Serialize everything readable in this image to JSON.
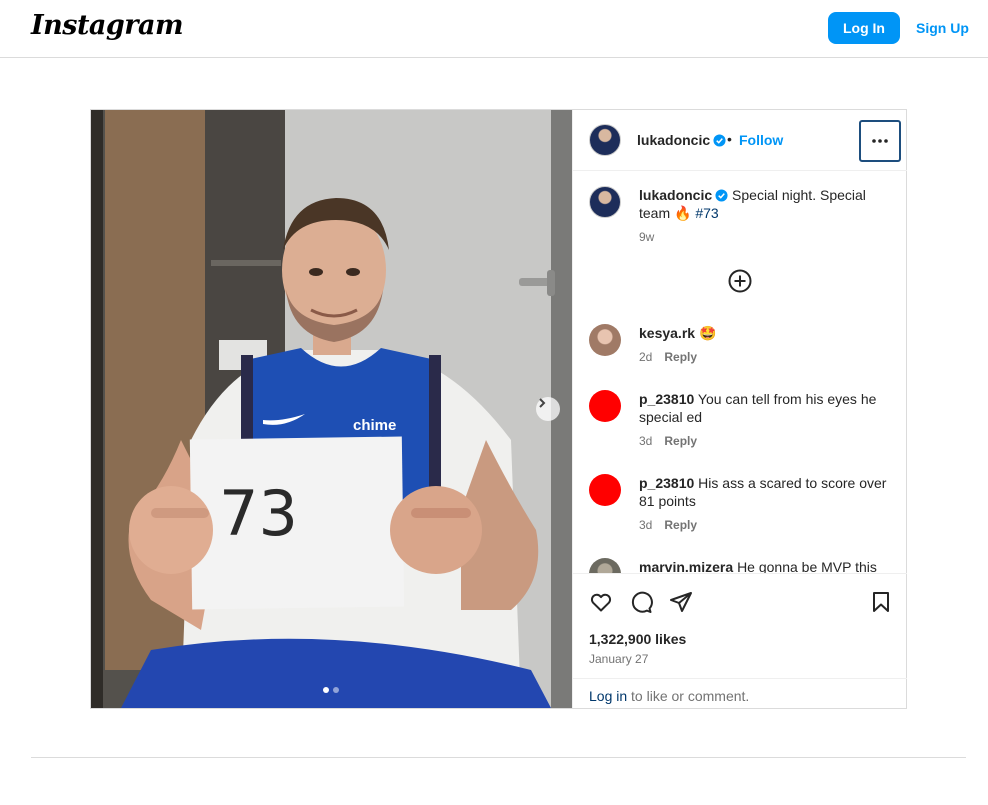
{
  "header": {
    "logo": "Instagram",
    "login_label": "Log In",
    "signup_label": "Sign Up"
  },
  "post": {
    "author": "lukadoncic",
    "separator": "•",
    "follow_label": "Follow",
    "more_icon": "more-horizontal-icon",
    "carousel": {
      "total_slides": 2,
      "active_slide": 1
    },
    "caption": {
      "username": "lukadoncic",
      "text_before": "Special night. Special team 🔥 ",
      "hashtag": "#73",
      "age": "9w"
    },
    "comments": [
      {
        "username": "kesya.rk",
        "text": "🤩",
        "age": "2d",
        "reply_label": "Reply",
        "avatar_color": "#c9a28c"
      },
      {
        "username": "p_23810",
        "text": "You can tell from his eyes he special ed",
        "age": "3d",
        "reply_label": "Reply",
        "avatar_color": "#ff0000"
      },
      {
        "username": "p_23810",
        "text": "His ass a scared to score over 81 points",
        "age": "3d",
        "reply_label": "Reply",
        "avatar_color": "#ff0000"
      },
      {
        "username": "marvin.mizera",
        "text": "He gonna be MVP this",
        "age": "",
        "reply_label": "",
        "avatar_color": "#8c8c7c"
      }
    ],
    "likes": "1,322,900 likes",
    "date": "January 27",
    "login_prompt": {
      "link": "Log in",
      "rest": " to like or comment."
    },
    "photo_sign_text": "73",
    "jersey_text": "chime"
  },
  "colors": {
    "accent": "#0095f6",
    "border": "#dbdbdb",
    "muted": "#737373"
  }
}
